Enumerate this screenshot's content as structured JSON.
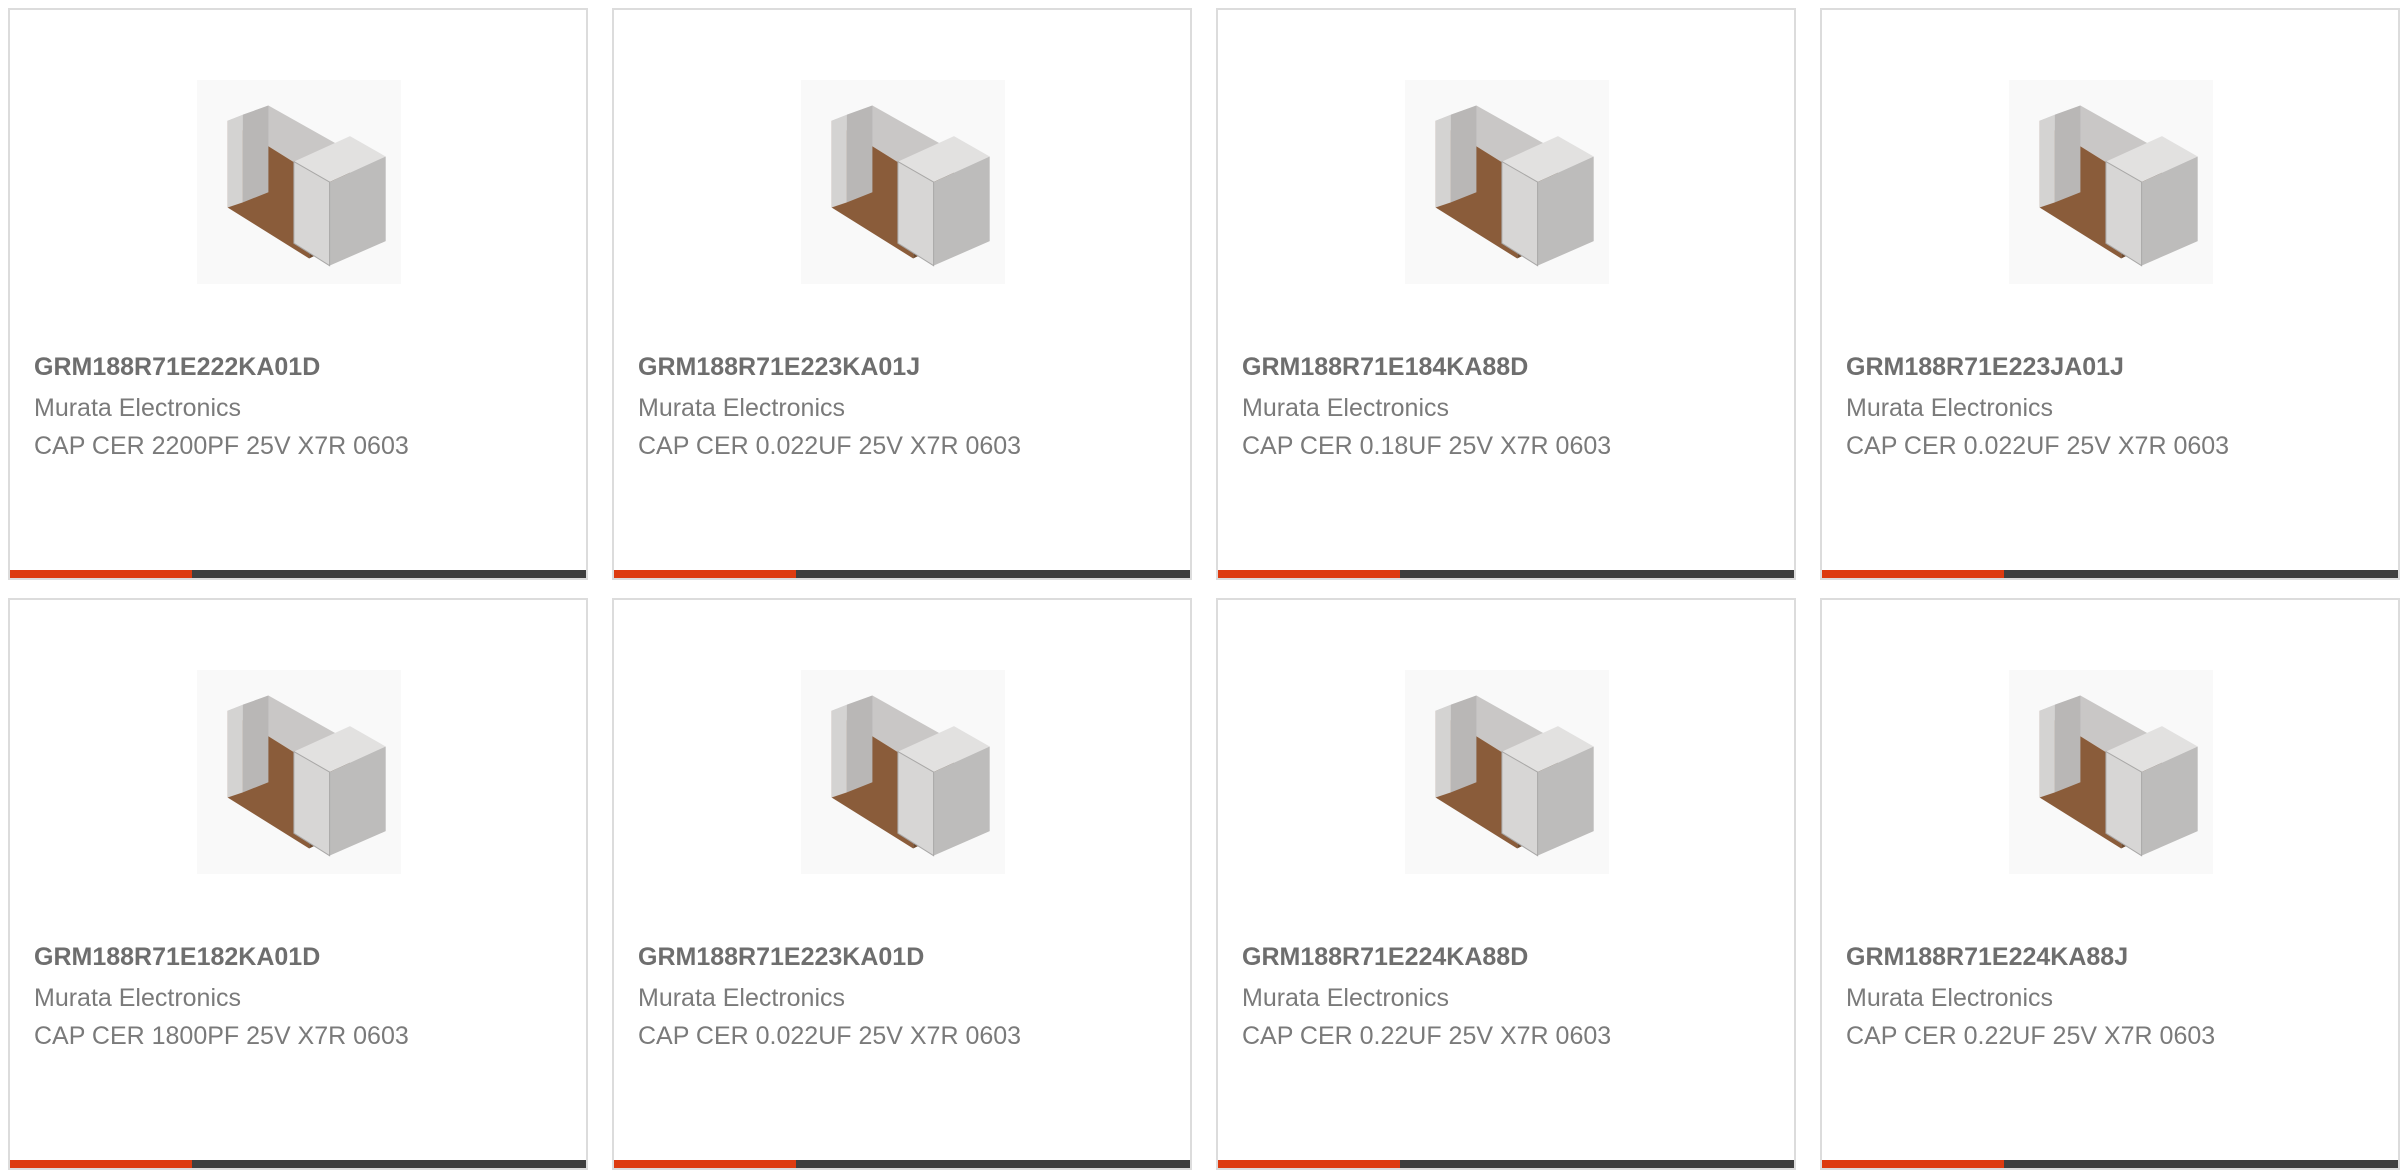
{
  "colors": {
    "accent": "#dd3b10",
    "bar": "#3f3f3f",
    "border": "#dcdcdc",
    "text": "#7a7a7a",
    "title": "#6e6e6e"
  },
  "products": [
    {
      "part_number": "GRM188R71E222KA01D",
      "manufacturer": "Murata Electronics",
      "description": "CAP CER 2200PF 25V X7R 0603",
      "image_icon": "ceramic-capacitor-chip-icon"
    },
    {
      "part_number": "GRM188R71E223KA01J",
      "manufacturer": "Murata Electronics",
      "description": "CAP CER 0.022UF 25V X7R 0603",
      "image_icon": "ceramic-capacitor-chip-icon"
    },
    {
      "part_number": "GRM188R71E184KA88D",
      "manufacturer": "Murata Electronics",
      "description": "CAP CER 0.18UF 25V X7R 0603",
      "image_icon": "ceramic-capacitor-chip-icon"
    },
    {
      "part_number": "GRM188R71E223JA01J",
      "manufacturer": "Murata Electronics",
      "description": "CAP CER 0.022UF 25V X7R 0603",
      "image_icon": "ceramic-capacitor-chip-icon"
    },
    {
      "part_number": "GRM188R71E182KA01D",
      "manufacturer": "Murata Electronics",
      "description": "CAP CER 1800PF 25V X7R 0603",
      "image_icon": "ceramic-capacitor-chip-icon"
    },
    {
      "part_number": "GRM188R71E223KA01D",
      "manufacturer": "Murata Electronics",
      "description": "CAP CER 0.022UF 25V X7R 0603",
      "image_icon": "ceramic-capacitor-chip-icon"
    },
    {
      "part_number": "GRM188R71E224KA88D",
      "manufacturer": "Murata Electronics",
      "description": "CAP CER 0.22UF 25V X7R 0603",
      "image_icon": "ceramic-capacitor-chip-icon"
    },
    {
      "part_number": "GRM188R71E224KA88J",
      "manufacturer": "Murata Electronics",
      "description": "CAP CER 0.22UF 25V X7R 0603",
      "image_icon": "ceramic-capacitor-chip-icon"
    }
  ]
}
